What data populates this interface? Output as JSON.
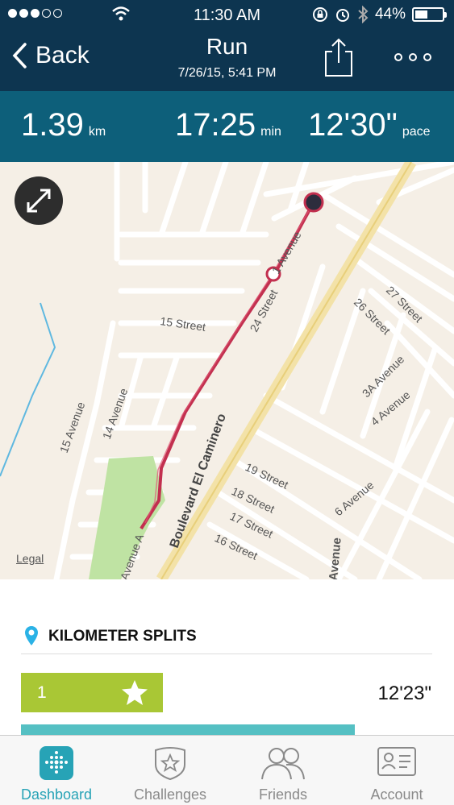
{
  "status_bar": {
    "time": "11:30 AM",
    "battery": "44%",
    "battery_level": 0.44
  },
  "nav": {
    "back_label": "Back",
    "title": "Run",
    "subtitle": "7/26/15, 5:41 PM"
  },
  "stats": {
    "distance_value": "1.39",
    "distance_unit": "km",
    "duration_value": "17:25",
    "duration_unit": "min",
    "pace_value": "12'30\"",
    "pace_unit": "pace"
  },
  "map": {
    "legal_label": "Legal",
    "streets": [
      "1 Avenue",
      "24 Street",
      "15 Street",
      "26 Street",
      "27 Street",
      "3A Avenue",
      "4 Avenue",
      "15 Avenue",
      "14 Avenue",
      "Boulevard El Caminero",
      "19 Street",
      "18 Street",
      "17 Street",
      "16 Street",
      "6 Avenue",
      "Avenue A",
      "Avenue"
    ],
    "route_color": "#c2304f"
  },
  "splits": {
    "title": "KILOMETER SPLITS",
    "items": [
      {
        "number": "1",
        "time": "12'23\""
      }
    ],
    "bar_color": "#a9c735"
  },
  "tabs": [
    {
      "label": "Dashboard",
      "active": true
    },
    {
      "label": "Challenges",
      "active": false
    },
    {
      "label": "Friends",
      "active": false
    },
    {
      "label": "Account",
      "active": false
    }
  ]
}
